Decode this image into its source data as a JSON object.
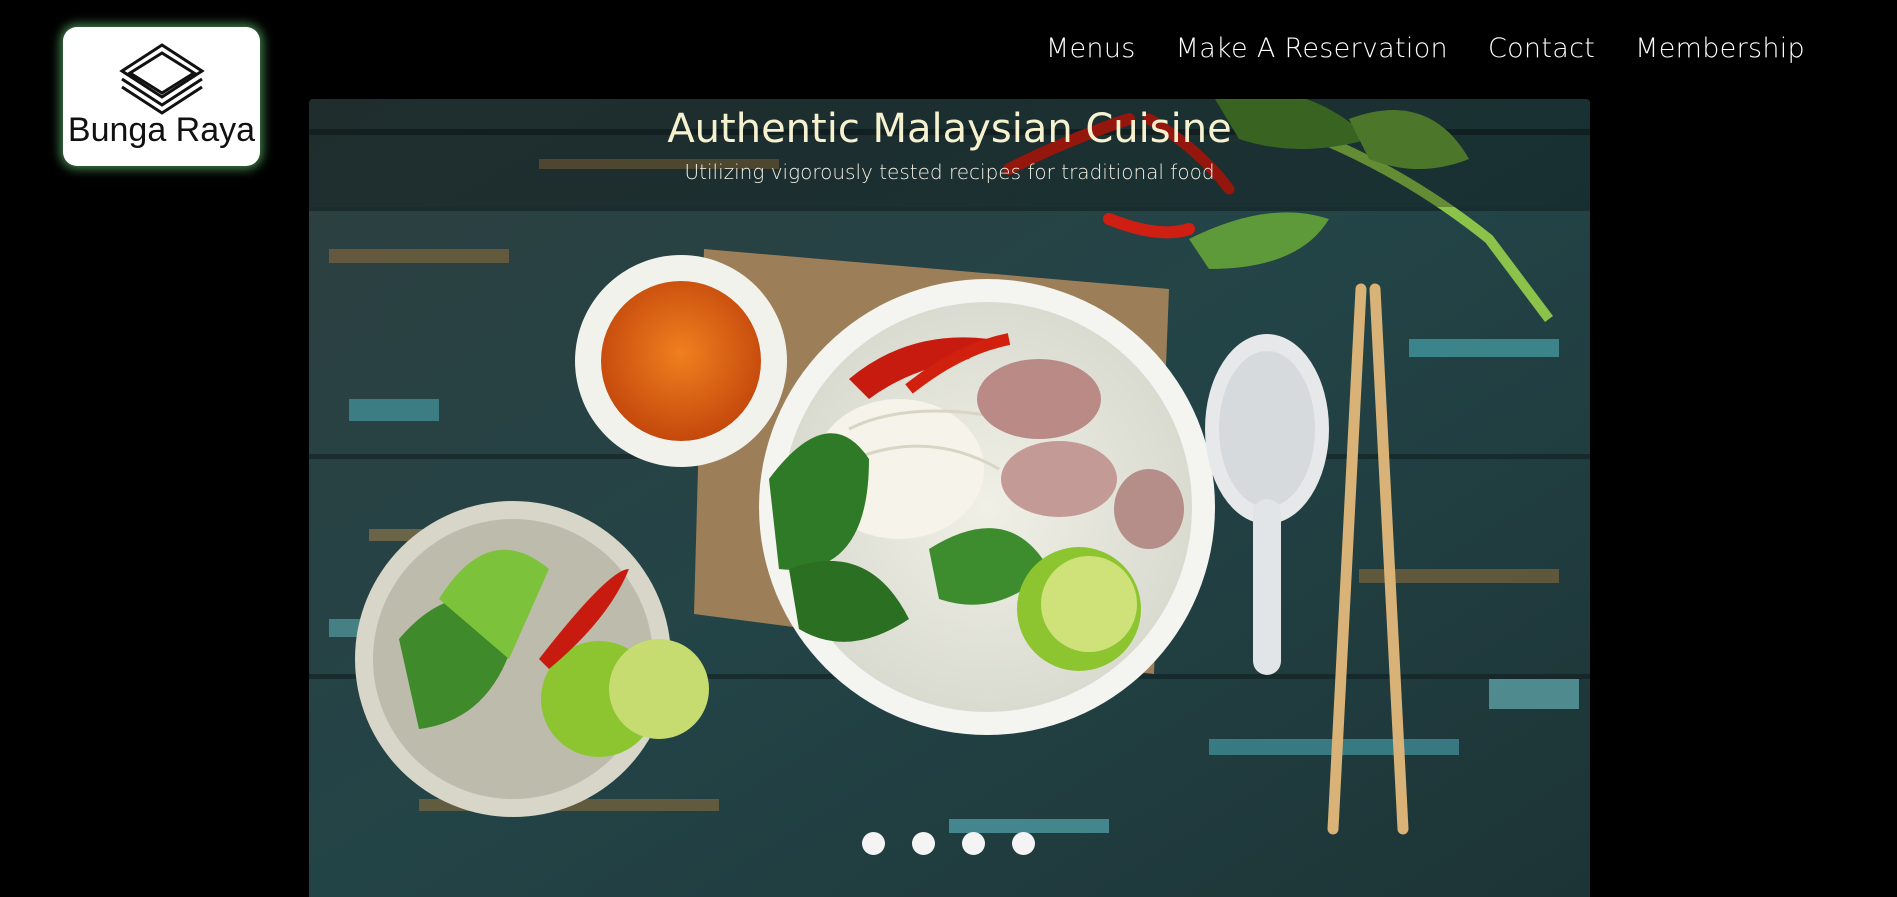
{
  "brand": {
    "name": "Bunga Raya"
  },
  "nav": {
    "items": [
      {
        "label": "Menus"
      },
      {
        "label": "Make A Reservation"
      },
      {
        "label": "Contact"
      },
      {
        "label": "Membership"
      }
    ]
  },
  "hero": {
    "title": "Authentic Malaysian Cuisine",
    "subtitle": "Utilizing vigorously tested recipes for traditional food",
    "slide_count": 4
  },
  "colors": {
    "background": "#000000",
    "logo_glow": "#78eb8c",
    "title_text": "#f6f1cf",
    "nav_text": "#ffffff"
  }
}
